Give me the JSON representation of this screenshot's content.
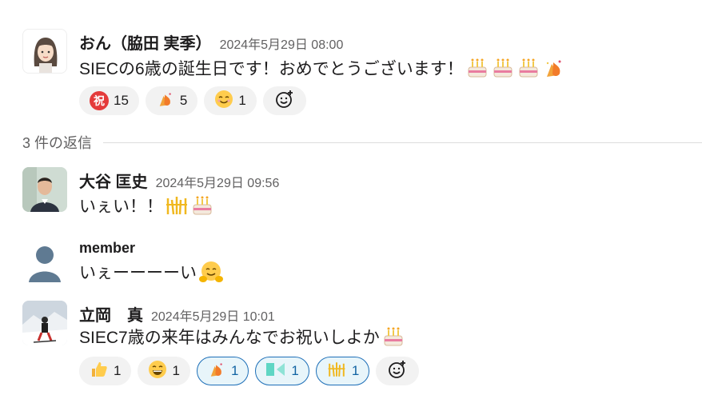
{
  "messages": [
    {
      "name": "おん（脇田 実季）",
      "time": "2024年5月29日 08:00",
      "text": "SIECの6歳の誕生日です！おめでとうございます！",
      "reactions": [
        {
          "emoji": "祝",
          "count": "15"
        },
        {
          "emoji": "fire-party",
          "count": "5"
        },
        {
          "emoji": "smile",
          "count": "1"
        }
      ]
    }
  ],
  "replies_label": "3 件の返信",
  "replies": [
    {
      "name": "大谷 匡史",
      "time": "2024年5月29日 09:56",
      "text": "いぇい！！"
    },
    {
      "name": "member",
      "time": "",
      "text": "いぇーーーーい"
    },
    {
      "name": "立岡　真",
      "time": "2024年5月29日 10:01",
      "text": "SIEC7歳の来年はみんなでお祝いしよか",
      "reactions": [
        {
          "emoji": "thumbs-up",
          "count": "1"
        },
        {
          "emoji": "grin",
          "count": "1"
        },
        {
          "emoji": "fire-party",
          "count": "1",
          "selected": true
        },
        {
          "emoji": "custom",
          "count": "1",
          "selected": true
        },
        {
          "emoji": "sparkle-dance",
          "count": "1",
          "selected": true
        }
      ]
    }
  ],
  "colors": {
    "accent": "#1264a3",
    "selected_bg": "#e8f5fa",
    "pill_bg": "#f2f2f2"
  }
}
